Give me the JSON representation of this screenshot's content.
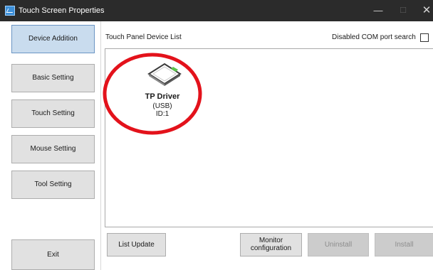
{
  "window": {
    "title": "Touch Screen Properties",
    "minimize_glyph": "—",
    "maximize_glyph": "☐",
    "close_glyph": "✕"
  },
  "sidebar": {
    "items": [
      {
        "label": "Device Addition",
        "selected": true
      },
      {
        "label": "Basic Setting",
        "selected": false
      },
      {
        "label": "Touch Setting",
        "selected": false
      },
      {
        "label": "Mouse Setting",
        "selected": false
      },
      {
        "label": "Tool Setting",
        "selected": false
      }
    ],
    "exit_label": "Exit"
  },
  "main": {
    "list_label": "Touch Panel Device List",
    "com_search_label": "Disabled COM port search",
    "com_search_checked": false,
    "devices": [
      {
        "name": "TP Driver",
        "connection": "(USB)",
        "id": "ID:1",
        "icon": "touch-panel-icon"
      }
    ],
    "buttons": {
      "list_update": "List Update",
      "monitor_line1": "Monitor",
      "monitor_line2": "configuration",
      "uninstall": "Uninstall",
      "install": "Install"
    }
  },
  "colors": {
    "titlebar": "#2b2b2b",
    "selected_button": "#c9dcee",
    "button": "#e1e1e1",
    "disabled_button": "#cccccc",
    "highlight_ring": "#e3121b",
    "panel_icon_accent": "#5bc24a"
  }
}
